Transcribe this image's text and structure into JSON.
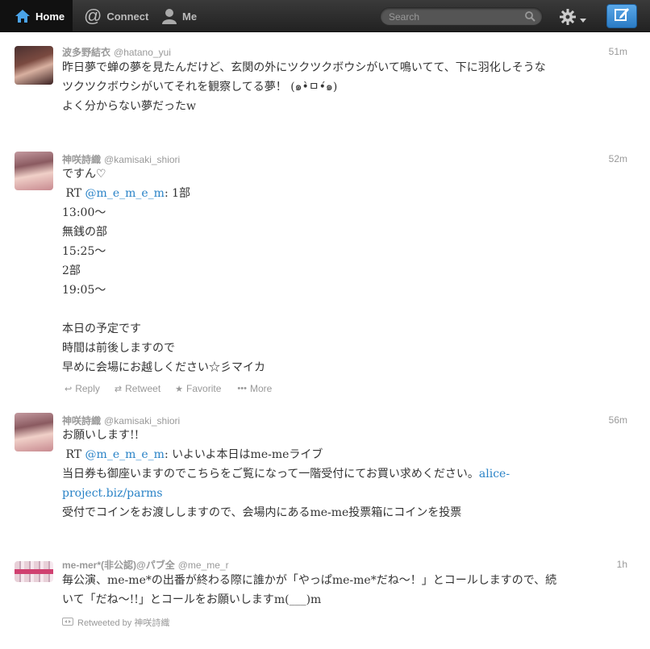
{
  "nav": {
    "home": "Home",
    "connect": "Connect",
    "me": "Me",
    "search_placeholder": "Search"
  },
  "colors": {
    "accent": "#2a83c7",
    "topbar": "#2e2e2e",
    "compose": "#3a8fd8"
  },
  "tweets": [
    {
      "name": "波多野結衣",
      "handle": "@hatano_yui",
      "time": "51m",
      "lines": [
        "昨日夢で蝉の夢を見たんだけど、玄関の外にツクツクボウシがいて鳴いてて、下に羽化しそうな",
        "ツクツクボウシがいてそれを観察してる夢！ (๑•̀ㅁ•́๑)",
        "よく分からない夢だったw"
      ]
    },
    {
      "name": "神咲詩織",
      "handle": "@kamisaki_shiori",
      "time": "52m",
      "l1": "ですん♡",
      "rt_prefix": " RT ",
      "rt_user": "@m_e_m_e_m",
      "rt_rest": ": 1部",
      "l3": "13:00～",
      "l4": "無銭の部",
      "l5": "15:25～",
      "l6": "2部",
      "l7": "19:05～",
      "l8": "本日の予定です",
      "l9": "時間は前後しますので",
      "l10": "早めに会場にお越しください☆彡マイカ",
      "actions": {
        "reply": "Reply",
        "retweet": "Retweet",
        "favorite": "Favorite",
        "more": "More"
      }
    },
    {
      "name": "神咲詩織",
      "handle": "@kamisaki_shiori",
      "time": "56m",
      "l1": "お願いします!!",
      "rt_prefix": " RT ",
      "rt_user": "@m_e_m_e_m",
      "rt_rest": ": いよいよ本日はme-meライブ",
      "l3a": "当日券も御座いますのでこちらをご覧になって一階受付にてお買い求めください。",
      "link1": "alice-",
      "link2": "project.biz/parms",
      "l5": "受付でコインをお渡ししますので、会場内にあるme-me投票箱にコインを投票"
    },
    {
      "name": "me-mer*(非公認)@パブ全",
      "handle": "@me_me_r",
      "time": "1h",
      "l1": "毎公演、me-me*の出番が終わる際に誰かが「やっぱme-me*だね～！」とコールしますので、続",
      "l2": "いて「だね～!!」とコールをお願いしますm(___)m",
      "retweeted_by": "Retweeted by 神咲詩織"
    }
  ]
}
